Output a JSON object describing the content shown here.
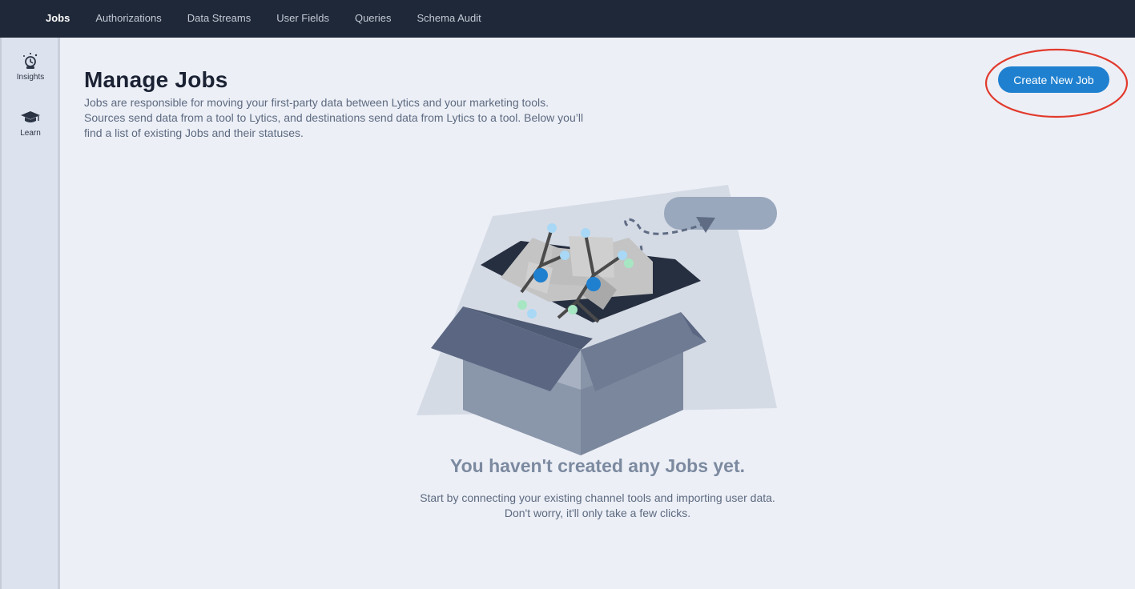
{
  "nav": {
    "tabs": [
      {
        "label": "Jobs",
        "active": true
      },
      {
        "label": "Authorizations"
      },
      {
        "label": "Data Streams"
      },
      {
        "label": "User Fields"
      },
      {
        "label": "Queries"
      },
      {
        "label": "Schema Audit"
      }
    ]
  },
  "sidebar": {
    "items": [
      {
        "label": "Insights",
        "icon": "insights-icon"
      },
      {
        "label": "Learn",
        "icon": "graduation-cap-icon"
      }
    ]
  },
  "page": {
    "title": "Manage Jobs",
    "description": "Jobs are responsible for moving your first-party data between Lytics and your marketing tools. Sources send data from a tool to Lytics, and destinations send data from Lytics to a tool. Below you’ll find a list of existing Jobs and their statuses.",
    "create_button": "Create New Job"
  },
  "empty_state": {
    "title": "You haven't created any Jobs yet.",
    "line1": "Start by connecting your existing channel tools and importing user data.",
    "line2": "Don't worry, it'll only take a few clicks."
  },
  "colors": {
    "nav_bg": "#1f2838",
    "accent": "#1f80cf",
    "annotation": "#e23a2c"
  }
}
